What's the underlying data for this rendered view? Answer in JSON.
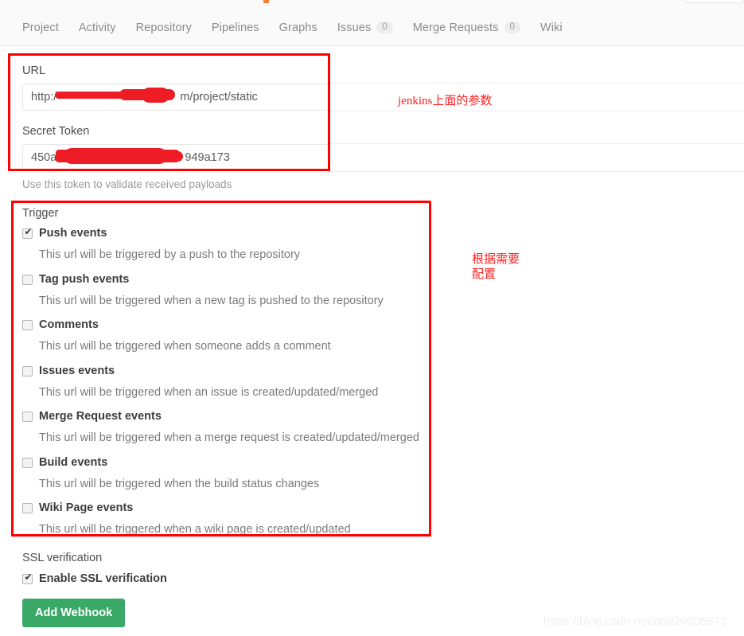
{
  "nav": {
    "items": [
      {
        "label": "Project",
        "badge": null
      },
      {
        "label": "Activity",
        "badge": null
      },
      {
        "label": "Repository",
        "badge": null
      },
      {
        "label": "Pipelines",
        "badge": null
      },
      {
        "label": "Graphs",
        "badge": null
      },
      {
        "label": "Issues",
        "badge": "0"
      },
      {
        "label": "Merge Requests",
        "badge": "0"
      },
      {
        "label": "Wiki",
        "badge": null
      }
    ]
  },
  "form": {
    "url_label": "URL",
    "url_value": "http://jenkinsxxxxxxxxxxm/project/static",
    "url_value_prefix": "http:/",
    "url_value_suffix": "m/project/static",
    "token_label": "Secret Token",
    "token_value_prefix": "450a0e",
    "token_value_suffix": "949a173",
    "token_help": "Use this token to validate received payloads"
  },
  "trigger": {
    "section_label": "Trigger",
    "items": [
      {
        "label": "Push events",
        "checked": true,
        "desc": "This url will be triggered by a push to the repository"
      },
      {
        "label": "Tag push events",
        "checked": false,
        "desc": "This url will be triggered when a new tag is pushed to the repository"
      },
      {
        "label": "Comments",
        "checked": false,
        "desc": "This url will be triggered when someone adds a comment"
      },
      {
        "label": "Issues events",
        "checked": false,
        "desc": "This url will be triggered when an issue is created/updated/merged"
      },
      {
        "label": "Merge Request events",
        "checked": false,
        "desc": "This url will be triggered when a merge request is created/updated/merged"
      },
      {
        "label": "Build events",
        "checked": false,
        "desc": "This url will be triggered when the build status changes"
      },
      {
        "label": "Wiki Page events",
        "checked": false,
        "desc": "This url will be triggered when a wiki page is created/updated"
      }
    ]
  },
  "ssl": {
    "section_label": "SSL verification",
    "checkbox_label": "Enable SSL verification",
    "checked": true
  },
  "actions": {
    "add_webhook_label": "Add Webhook"
  },
  "annotations": {
    "note_url": "jenkins上面的参数",
    "note_trigger": "根据需要\n配置",
    "accent_red": "#ff0000"
  },
  "watermark": {
    "text": "https://blog.csdn.net/qq920006873"
  }
}
